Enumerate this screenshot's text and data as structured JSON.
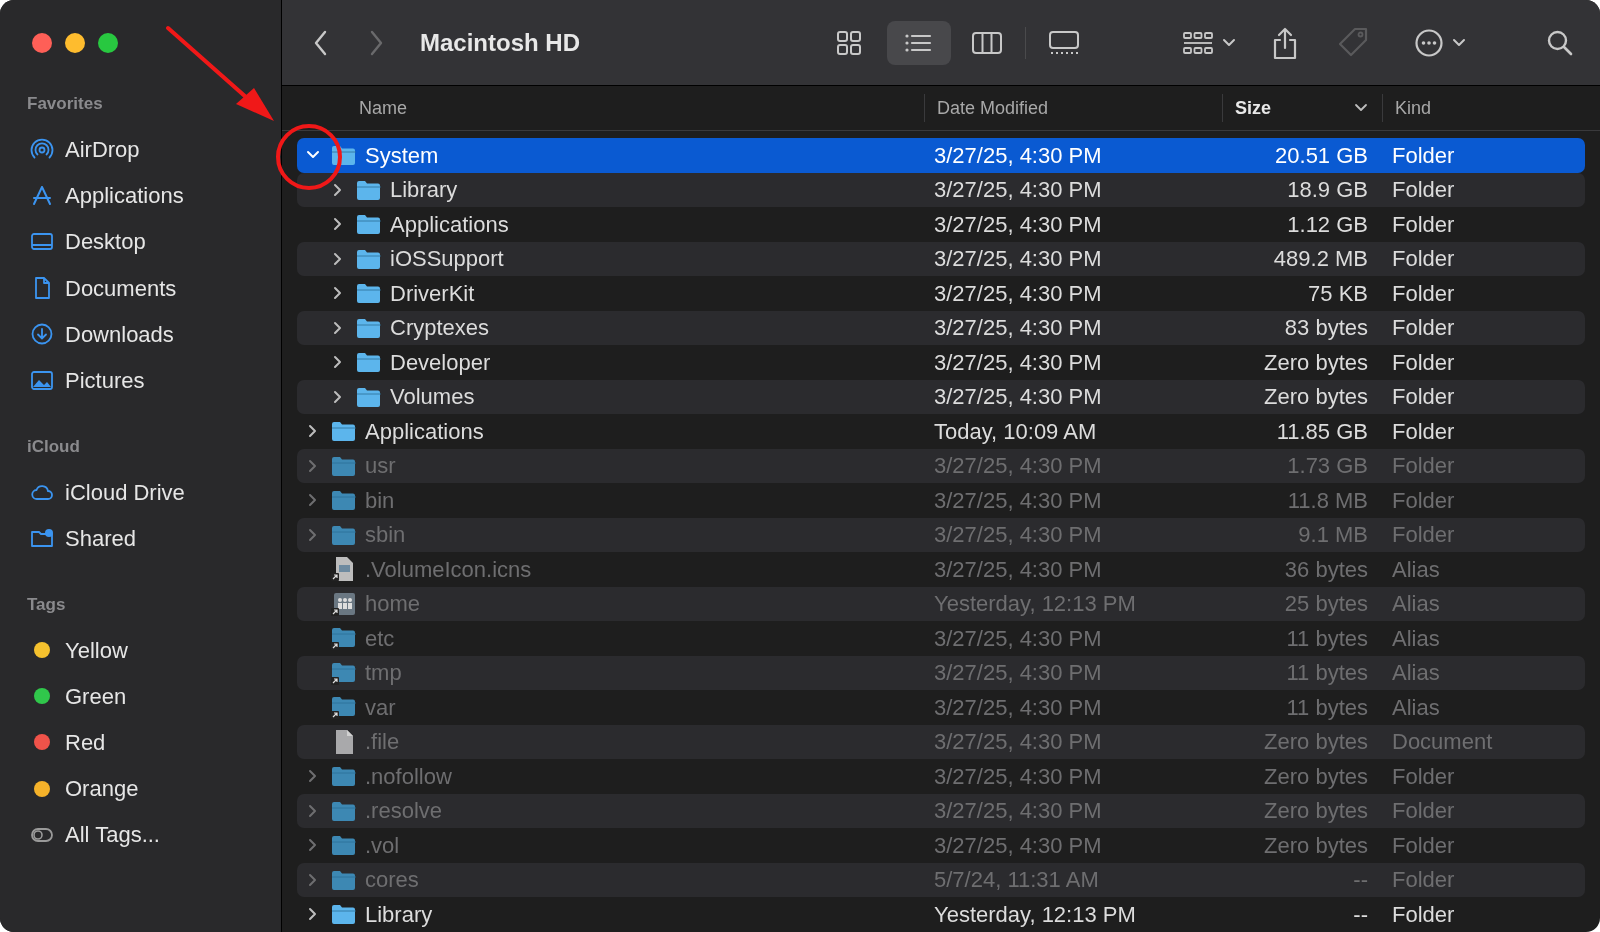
{
  "window": {
    "title": "Macintosh HD"
  },
  "toolbar": {
    "back_enabled": true,
    "forward_enabled": false,
    "tag_enabled": false,
    "view_modes": [
      {
        "kind": "icons",
        "selected": false
      },
      {
        "kind": "list",
        "selected": true
      },
      {
        "kind": "columns",
        "selected": false
      },
      {
        "kind": "gallery",
        "selected": false
      }
    ]
  },
  "sidebar": {
    "sections": [
      {
        "title": "Favorites",
        "items": [
          {
            "label": "AirDrop"
          },
          {
            "label": "Applications"
          },
          {
            "label": "Desktop"
          },
          {
            "label": "Documents"
          },
          {
            "label": "Downloads"
          },
          {
            "label": "Pictures"
          }
        ]
      },
      {
        "title": "iCloud",
        "items": [
          {
            "label": "iCloud Drive"
          },
          {
            "label": "Shared"
          }
        ]
      },
      {
        "title": "Tags",
        "items": [
          {
            "label": "Yellow",
            "color": "#f5c12e"
          },
          {
            "label": "Green",
            "color": "#30c74b"
          },
          {
            "label": "Red",
            "color": "#f0534a"
          },
          {
            "label": "Orange",
            "color": "#f5b22a"
          },
          {
            "label": "All Tags..."
          }
        ]
      }
    ]
  },
  "table": {
    "columns": [
      {
        "label": "Name",
        "sorted": false
      },
      {
        "label": "Date Modified",
        "sorted": false
      },
      {
        "label": "Size",
        "sorted": true
      },
      {
        "label": "Kind",
        "sorted": false
      }
    ],
    "rows": [
      {
        "name": "System",
        "date": "3/27/25, 4:30 PM",
        "size": "20.51 GB",
        "kind_label": "Folder",
        "kind": "folder",
        "dimmed": false,
        "selected": true,
        "expanded": true,
        "children": [
          {
            "name": "Library",
            "date": "3/27/25, 4:30 PM",
            "size": "18.9 GB",
            "kind_label": "Folder",
            "kind": "folder",
            "dimmed": false,
            "selected": false,
            "expanded": false
          },
          {
            "name": "Applications",
            "date": "3/27/25, 4:30 PM",
            "size": "1.12 GB",
            "kind_label": "Folder",
            "kind": "folder",
            "dimmed": false,
            "selected": false,
            "expanded": false
          },
          {
            "name": "iOSSupport",
            "date": "3/27/25, 4:30 PM",
            "size": "489.2 MB",
            "kind_label": "Folder",
            "kind": "folder",
            "dimmed": false,
            "selected": false,
            "expanded": false
          },
          {
            "name": "DriverKit",
            "date": "3/27/25, 4:30 PM",
            "size": "75 KB",
            "kind_label": "Folder",
            "kind": "folder",
            "dimmed": false,
            "selected": false,
            "expanded": false
          },
          {
            "name": "Cryptexes",
            "date": "3/27/25, 4:30 PM",
            "size": "83 bytes",
            "kind_label": "Folder",
            "kind": "folder",
            "dimmed": false,
            "selected": false,
            "expanded": false
          },
          {
            "name": "Developer",
            "date": "3/27/25, 4:30 PM",
            "size": "Zero bytes",
            "kind_label": "Folder",
            "kind": "folder",
            "dimmed": false,
            "selected": false,
            "expanded": false
          },
          {
            "name": "Volumes",
            "date": "3/27/25, 4:30 PM",
            "size": "Zero bytes",
            "kind_label": "Folder",
            "kind": "folder",
            "dimmed": false,
            "selected": false,
            "expanded": false
          }
        ]
      },
      {
        "name": "Applications",
        "date": "Today, 10:09 AM",
        "size": "11.85 GB",
        "kind_label": "Folder",
        "kind": "folder",
        "dimmed": false,
        "selected": false,
        "expanded": false
      },
      {
        "name": "usr",
        "date": "3/27/25, 4:30 PM",
        "size": "1.73 GB",
        "kind_label": "Folder",
        "kind": "folder",
        "dimmed": true,
        "selected": false,
        "expanded": false
      },
      {
        "name": "bin",
        "date": "3/27/25, 4:30 PM",
        "size": "11.8 MB",
        "kind_label": "Folder",
        "kind": "folder",
        "dimmed": true,
        "selected": false,
        "expanded": false
      },
      {
        "name": "sbin",
        "date": "3/27/25, 4:30 PM",
        "size": "9.1 MB",
        "kind_label": "Folder",
        "kind": "folder",
        "dimmed": true,
        "selected": false,
        "expanded": false
      },
      {
        "name": ".VolumeIcon.icns",
        "date": "3/27/25, 4:30 PM",
        "size": "36 bytes",
        "kind_label": "Alias",
        "kind": "filealias",
        "dimmed": true,
        "selected": false
      },
      {
        "name": "home",
        "date": "Yesterday, 12:13 PM",
        "size": "25 bytes",
        "kind_label": "Alias",
        "kind": "homealias",
        "dimmed": true,
        "selected": false
      },
      {
        "name": "etc",
        "date": "3/27/25, 4:30 PM",
        "size": "11 bytes",
        "kind_label": "Alias",
        "kind": "folderalias",
        "dimmed": true,
        "selected": false
      },
      {
        "name": "tmp",
        "date": "3/27/25, 4:30 PM",
        "size": "11 bytes",
        "kind_label": "Alias",
        "kind": "folderalias",
        "dimmed": true,
        "selected": false
      },
      {
        "name": "var",
        "date": "3/27/25, 4:30 PM",
        "size": "11 bytes",
        "kind_label": "Alias",
        "kind": "folderalias",
        "dimmed": true,
        "selected": false
      },
      {
        "name": ".file",
        "date": "3/27/25, 4:30 PM",
        "size": "Zero bytes",
        "kind_label": "Document",
        "kind": "document",
        "dimmed": true,
        "selected": false
      },
      {
        "name": ".nofollow",
        "date": "3/27/25, 4:30 PM",
        "size": "Zero bytes",
        "kind_label": "Folder",
        "kind": "folder",
        "dimmed": true,
        "selected": false,
        "expanded": false
      },
      {
        "name": ".resolve",
        "date": "3/27/25, 4:30 PM",
        "size": "Zero bytes",
        "kind_label": "Folder",
        "kind": "folder",
        "dimmed": true,
        "selected": false,
        "expanded": false
      },
      {
        "name": ".vol",
        "date": "3/27/25, 4:30 PM",
        "size": "Zero bytes",
        "kind_label": "Folder",
        "kind": "folder",
        "dimmed": true,
        "selected": false,
        "expanded": false
      },
      {
        "name": "cores",
        "date": "5/7/24, 11:31 AM",
        "size": "--",
        "kind_label": "Folder",
        "kind": "folder",
        "dimmed": true,
        "selected": false,
        "expanded": false
      },
      {
        "name": "Library",
        "date": "Yesterday, 12:13 PM",
        "size": "--",
        "kind_label": "Folder",
        "kind": "folder",
        "dimmed": false,
        "selected": false,
        "expanded": false
      }
    ]
  },
  "annotation": {
    "arrow": true,
    "circle": true
  }
}
